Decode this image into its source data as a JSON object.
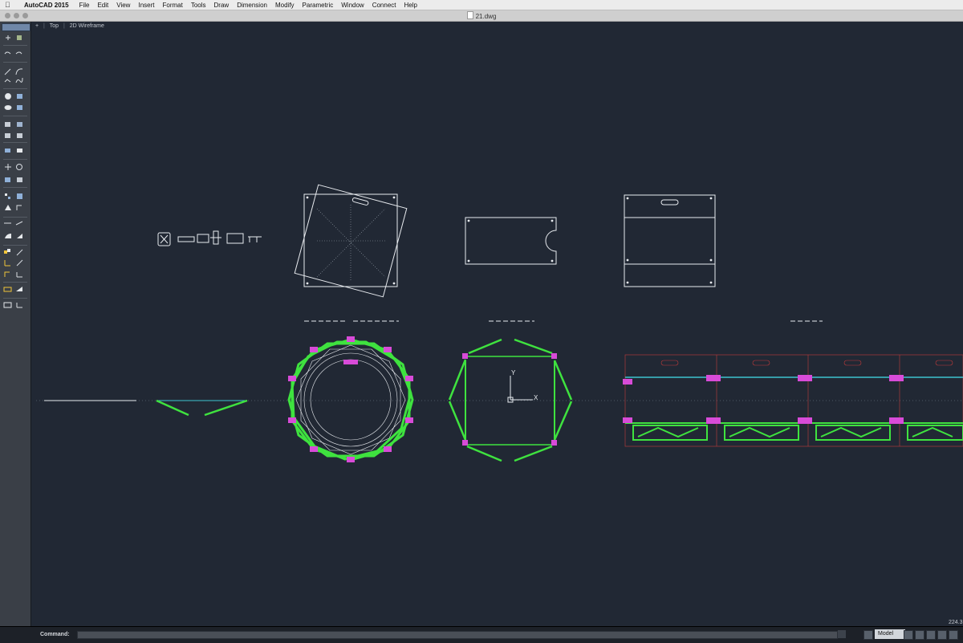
{
  "menubar": {
    "app_name": "AutoCAD 2015",
    "items": [
      "File",
      "Edit",
      "View",
      "Insert",
      "Format",
      "Tools",
      "Draw",
      "Dimension",
      "Modify",
      "Parametric",
      "Window",
      "Connect",
      "Help"
    ]
  },
  "window": {
    "title": "21.dwg"
  },
  "viewport_controls": {
    "minus": "+",
    "view": "Top",
    "visual_style": "2D Wireframe"
  },
  "ucs": {
    "x_label": "X",
    "y_label": "Y"
  },
  "command": {
    "label": "Command:",
    "value": ""
  },
  "status": {
    "coordinates": "224.3",
    "model_tab": "Model"
  },
  "colors": {
    "background": "#212834",
    "line_white": "#e8ebef",
    "line_green": "#3fe23f",
    "line_cyan": "#3ec3cf",
    "line_magenta": "#d84bd8",
    "line_red": "#c23b3b"
  },
  "toolbar_icons": [
    "line-icon",
    "arc-icon",
    "polyline-icon",
    "spline-icon",
    "circle-icon",
    "rectangle-icon",
    "ellipse-icon",
    "hatch-icon",
    "extrude-icon",
    "region-icon",
    "layer-icon",
    "erase-icon",
    "move-icon",
    "rotate-icon",
    "copy-icon",
    "mirror-icon",
    "array-icon",
    "scale-icon",
    "trim-icon",
    "extend-icon",
    "fillet-icon",
    "chamfer-icon",
    "dimension-linear-icon",
    "dimension-aligned-icon",
    "text-icon",
    "table-icon",
    "properties-icon",
    "matchprop-icon"
  ]
}
